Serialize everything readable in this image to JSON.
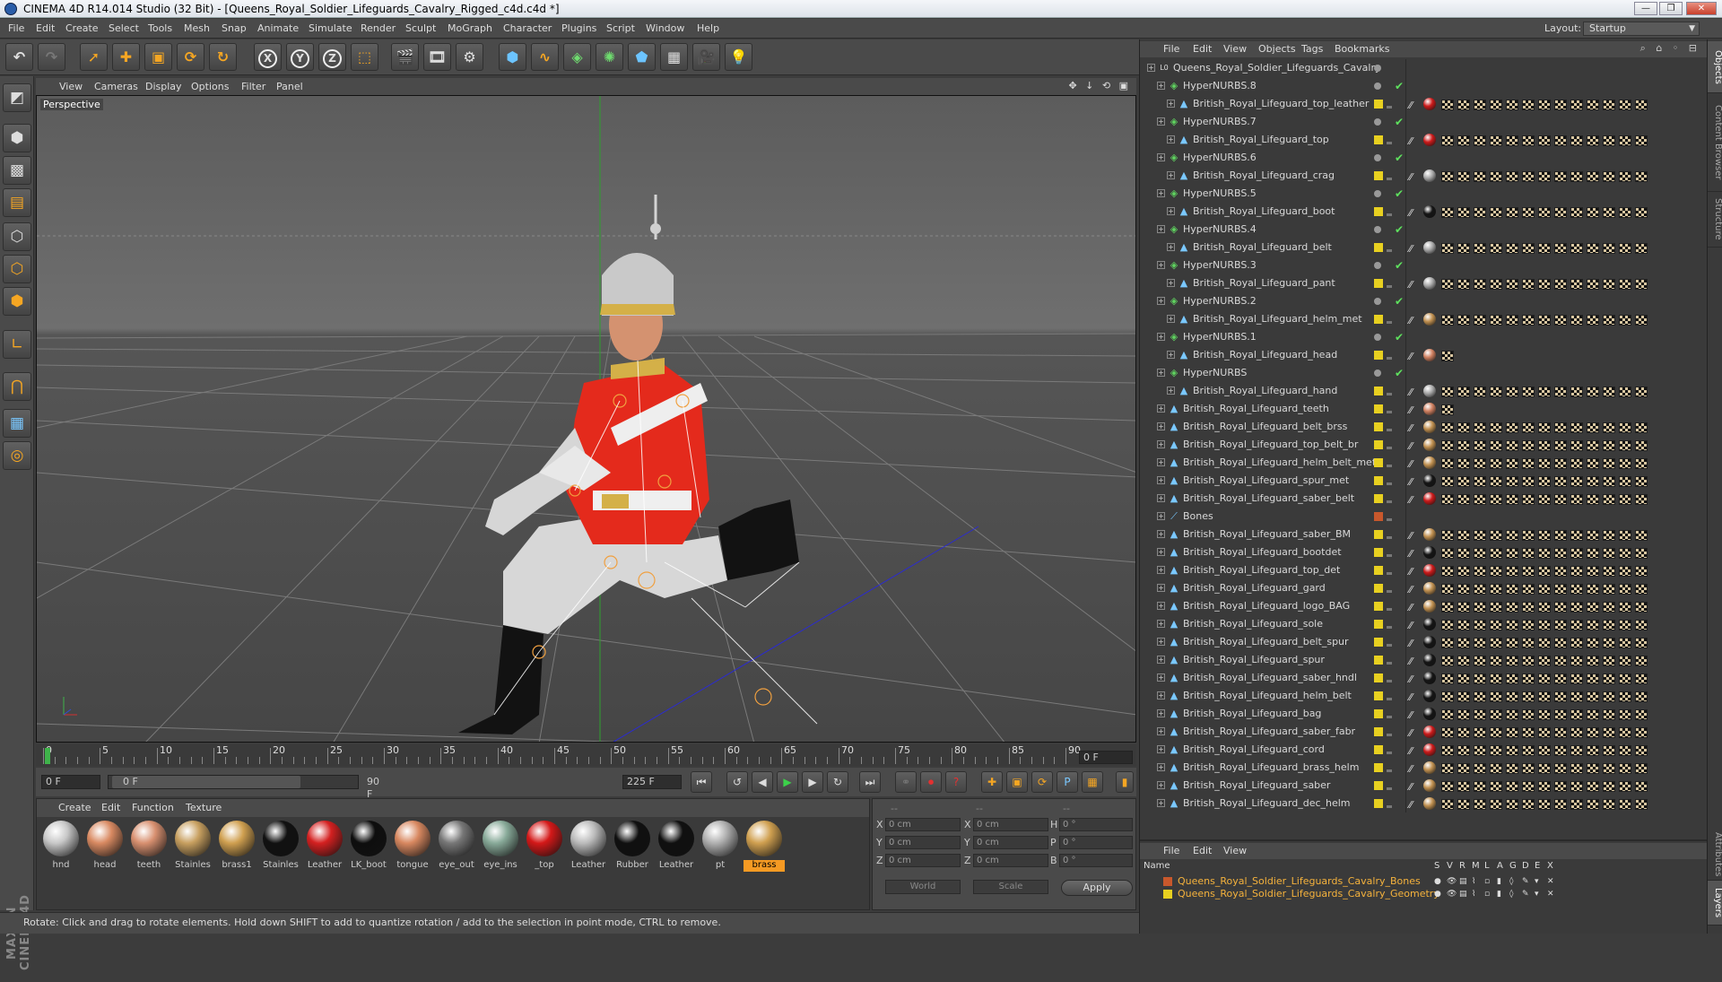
{
  "window": {
    "title": "CINEMA 4D R14.014 Studio (32 Bit) - [Queens_Royal_Soldier_Lifeguards_Cavalry_Rigged_c4d.c4d *]"
  },
  "menubar": {
    "items": [
      "File",
      "Edit",
      "Create",
      "Select",
      "Tools",
      "Mesh",
      "Snap",
      "Animate",
      "Simulate",
      "Render",
      "Sculpt",
      "MoGraph",
      "Character",
      "Plugins",
      "Script",
      "Window",
      "Help"
    ],
    "layout_label": "Layout:",
    "layout_value": "Startup"
  },
  "toolbar": {
    "axis_x": "X",
    "axis_y": "Y",
    "axis_z": "Z"
  },
  "viewport": {
    "menu": [
      "View",
      "Cameras",
      "Display",
      "Options",
      "Filter",
      "Panel"
    ],
    "label": "Perspective",
    "nav_icons": "✥ ↓ ⟲ ▣"
  },
  "timeline": {
    "ticks": [
      "0",
      "5",
      "10",
      "15",
      "20",
      "25",
      "30",
      "35",
      "40",
      "45",
      "50",
      "55",
      "60",
      "65",
      "70",
      "75",
      "80",
      "85",
      "90"
    ],
    "current_frame": "0 F"
  },
  "playback": {
    "start": "0 F",
    "range_start": "0 F",
    "range_end": "90 F",
    "end": "225 F"
  },
  "materials": {
    "menu": [
      "Create",
      "Edit",
      "Function",
      "Texture"
    ],
    "items": [
      {
        "label": "hnd",
        "color": "#c8c8c8"
      },
      {
        "label": "head",
        "color": "#d98a62"
      },
      {
        "label": "teeth",
        "color": "#d89070"
      },
      {
        "label": "Stainles",
        "color": "#c8a060"
      },
      {
        "label": "brass1",
        "color": "#d0a050"
      },
      {
        "label": "Stainles",
        "color": "#111111"
      },
      {
        "label": "Leather",
        "color": "#d42020"
      },
      {
        "label": "LK_boot",
        "color": "#0e0e0e"
      },
      {
        "label": "tongue",
        "color": "#d88860"
      },
      {
        "label": "eye_out",
        "color": "#777777"
      },
      {
        "label": "eye_ins",
        "color": "#88aa99"
      },
      {
        "label": "_top",
        "color": "#d41818"
      },
      {
        "label": "Leather",
        "color": "#bbbbbb"
      },
      {
        "label": "Rubber",
        "color": "#101010"
      },
      {
        "label": "Leather",
        "color": "#101010"
      },
      {
        "label": "pt",
        "color": "#b0b0b0"
      },
      {
        "label": "brass",
        "color": "#d0a050"
      }
    ],
    "selected_index": 16
  },
  "coords": {
    "header_dash": "--",
    "pos_labels": [
      "X",
      "Y",
      "Z"
    ],
    "size_labels": [
      "X",
      "Y",
      "Z"
    ],
    "rot_labels": [
      "H",
      "P",
      "B"
    ],
    "pos_values": [
      "0 cm",
      "0 cm",
      "0 cm"
    ],
    "size_values": [
      "0 cm",
      "0 cm",
      "0 cm"
    ],
    "rot_values": [
      "0 °",
      "0 °",
      "0 °"
    ],
    "mode_world": "World",
    "mode_scale": "Scale",
    "apply": "Apply"
  },
  "status": {
    "text": "Rotate: Click and drag to rotate elements. Hold down SHIFT to add to quantize rotation / add to the selection in point mode, CTRL to remove."
  },
  "objects": {
    "menu": [
      "File",
      "Edit",
      "View",
      "Objects",
      "Tags",
      "Bookmarks"
    ],
    "header_icons": "⌕ ⌂ ◦ ⊟",
    "rows": [
      {
        "name": "Queens_Royal_Soldier_Lifeguards_Cavalry",
        "indent": 0,
        "kind": "null",
        "tags": 0
      },
      {
        "name": "HyperNURBS.8",
        "indent": 1,
        "kind": "nurbs",
        "tags": 0
      },
      {
        "name": "British_Royal_Lifeguard_top_leather",
        "indent": 2,
        "kind": "mesh",
        "tags": 13,
        "tagColor": "#cc1a1a"
      },
      {
        "name": "HyperNURBS.7",
        "indent": 1,
        "kind": "nurbs",
        "tags": 0
      },
      {
        "name": "British_Royal_Lifeguard_top",
        "indent": 2,
        "kind": "mesh",
        "tags": 13,
        "tagColor": "#cc1a1a"
      },
      {
        "name": "HyperNURBS.6",
        "indent": 1,
        "kind": "nurbs",
        "tags": 0
      },
      {
        "name": "British_Royal_Lifeguard_crag",
        "indent": 2,
        "kind": "mesh",
        "tags": 13,
        "tagColor": "#aaaaaa"
      },
      {
        "name": "HyperNURBS.5",
        "indent": 1,
        "kind": "nurbs",
        "tags": 0
      },
      {
        "name": "British_Royal_Lifeguard_boot",
        "indent": 2,
        "kind": "mesh",
        "tags": 13,
        "tagColor": "#151515"
      },
      {
        "name": "HyperNURBS.4",
        "indent": 1,
        "kind": "nurbs",
        "tags": 0
      },
      {
        "name": "British_Royal_Lifeguard_belt",
        "indent": 2,
        "kind": "mesh",
        "tags": 13,
        "tagColor": "#aaaaaa"
      },
      {
        "name": "HyperNURBS.3",
        "indent": 1,
        "kind": "nurbs",
        "tags": 0
      },
      {
        "name": "British_Royal_Lifeguard_pant",
        "indent": 2,
        "kind": "mesh",
        "tags": 13,
        "tagColor": "#aaaaaa"
      },
      {
        "name": "HyperNURBS.2",
        "indent": 1,
        "kind": "nurbs",
        "tags": 0
      },
      {
        "name": "British_Royal_Lifeguard_helm_met",
        "indent": 2,
        "kind": "mesh",
        "tags": 13,
        "tagColor": "#c09050"
      },
      {
        "name": "HyperNURBS.1",
        "indent": 1,
        "kind": "nurbs",
        "tags": 0
      },
      {
        "name": "British_Royal_Lifeguard_head",
        "indent": 2,
        "kind": "mesh",
        "tags": 1,
        "tagColor": "#d08060"
      },
      {
        "name": "HyperNURBS",
        "indent": 1,
        "kind": "nurbs",
        "tags": 0
      },
      {
        "name": "British_Royal_Lifeguard_hand",
        "indent": 2,
        "kind": "mesh",
        "tags": 13,
        "tagColor": "#aaaaaa"
      },
      {
        "name": "British_Royal_Lifeguard_teeth",
        "indent": 1,
        "kind": "mesh",
        "tags": 1,
        "tagColor": "#d08060"
      },
      {
        "name": "British_Royal_Lifeguard_belt_brss",
        "indent": 1,
        "kind": "mesh",
        "tags": 13,
        "tagColor": "#c09050"
      },
      {
        "name": "British_Royal_Lifeguard_top_belt_br",
        "indent": 1,
        "kind": "mesh",
        "tags": 13,
        "tagColor": "#c09050"
      },
      {
        "name": "British_Royal_Lifeguard_helm_belt_met",
        "indent": 1,
        "kind": "mesh",
        "tags": 13,
        "tagColor": "#c09050"
      },
      {
        "name": "British_Royal_Lifeguard_spur_met",
        "indent": 1,
        "kind": "mesh",
        "tags": 13,
        "tagColor": "#151515"
      },
      {
        "name": "British_Royal_Lifeguard_saber_belt",
        "indent": 1,
        "kind": "mesh",
        "tags": 13,
        "tagColor": "#cc1a1a"
      },
      {
        "name": "Bones",
        "indent": 1,
        "kind": "bone",
        "tags": 0,
        "layer": "bones"
      },
      {
        "name": "British_Royal_Lifeguard_saber_BM",
        "indent": 1,
        "kind": "mesh",
        "tags": 13,
        "tagColor": "#c09050"
      },
      {
        "name": "British_Royal_Lifeguard_bootdet",
        "indent": 1,
        "kind": "mesh",
        "tags": 13,
        "tagColor": "#151515"
      },
      {
        "name": "British_Royal_Lifeguard_top_det",
        "indent": 1,
        "kind": "mesh",
        "tags": 13,
        "tagColor": "#cc1a1a"
      },
      {
        "name": "British_Royal_Lifeguard_gard",
        "indent": 1,
        "kind": "mesh",
        "tags": 13,
        "tagColor": "#c09050"
      },
      {
        "name": "British_Royal_Lifeguard_logo_BAG",
        "indent": 1,
        "kind": "mesh",
        "tags": 13,
        "tagColor": "#c09050"
      },
      {
        "name": "British_Royal_Lifeguard_sole",
        "indent": 1,
        "kind": "mesh",
        "tags": 13,
        "tagColor": "#151515"
      },
      {
        "name": "British_Royal_Lifeguard_belt_spur",
        "indent": 1,
        "kind": "mesh",
        "tags": 13,
        "tagColor": "#151515"
      },
      {
        "name": "British_Royal_Lifeguard_spur",
        "indent": 1,
        "kind": "mesh",
        "tags": 13,
        "tagColor": "#151515"
      },
      {
        "name": "British_Royal_Lifeguard_saber_hndl",
        "indent": 1,
        "kind": "mesh",
        "tags": 13,
        "tagColor": "#151515"
      },
      {
        "name": "British_Royal_Lifeguard_helm_belt",
        "indent": 1,
        "kind": "mesh",
        "tags": 13,
        "tagColor": "#151515"
      },
      {
        "name": "British_Royal_Lifeguard_bag",
        "indent": 1,
        "kind": "mesh",
        "tags": 13,
        "tagColor": "#151515"
      },
      {
        "name": "British_Royal_Lifeguard_saber_fabr",
        "indent": 1,
        "kind": "mesh",
        "tags": 13,
        "tagColor": "#cc1a1a"
      },
      {
        "name": "British_Royal_Lifeguard_cord",
        "indent": 1,
        "kind": "mesh",
        "tags": 13,
        "tagColor": "#cc1a1a"
      },
      {
        "name": "British_Royal_Lifeguard_brass_helm",
        "indent": 1,
        "kind": "mesh",
        "tags": 13,
        "tagColor": "#c09050"
      },
      {
        "name": "British_Royal_Lifeguard_saber",
        "indent": 1,
        "kind": "mesh",
        "tags": 13,
        "tagColor": "#c09050"
      },
      {
        "name": "British_Royal_Lifeguard_dec_helm",
        "indent": 1,
        "kind": "mesh",
        "tags": 13,
        "tagColor": "#c09050"
      }
    ]
  },
  "layers": {
    "menu": [
      "File",
      "Edit",
      "View"
    ],
    "header_name": "Name",
    "header_cols": [
      "S",
      "V",
      "R",
      "M",
      "L",
      "A",
      "G",
      "D",
      "E",
      "X"
    ],
    "rows": [
      {
        "name": "Queens_Royal_Soldier_Lifeguards_Cavalry_Bones",
        "color": "#c8582c"
      },
      {
        "name": "Queens_Royal_Soldier_Lifeguards_Cavalry_Geometry",
        "color": "#e8d020"
      }
    ]
  },
  "side_tabs": [
    "Objects",
    "Content Browser",
    "Structure",
    "Attributes",
    "Layers"
  ],
  "colors": {
    "accent": "#f5a623",
    "panel": "#4a4a4a",
    "viewport_bg": "#5e5e5e",
    "selection_yellow": "#e8d020"
  }
}
